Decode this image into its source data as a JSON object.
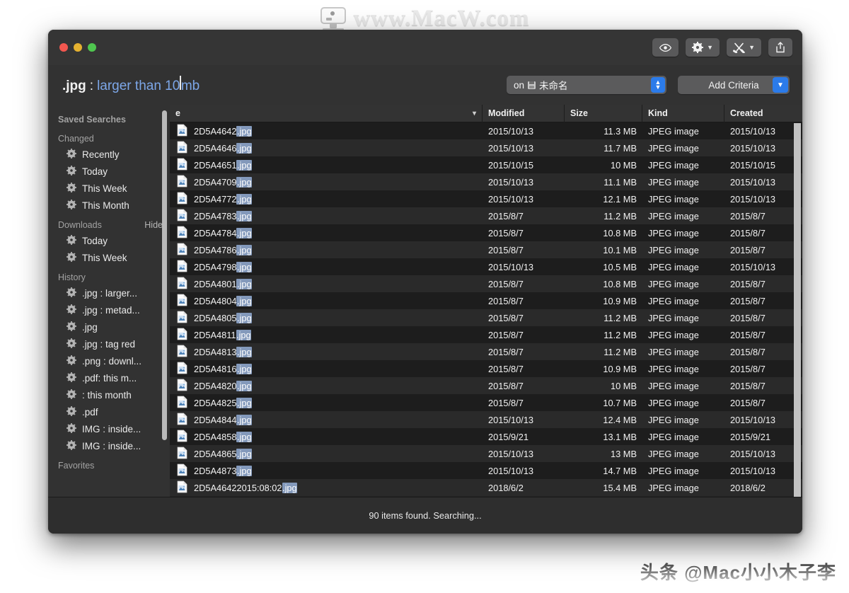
{
  "watermarks": {
    "top": "www.MacW.com",
    "bottom": "头条 @Mac小小木子李"
  },
  "window": {
    "traffic_lights": [
      "close",
      "minimize",
      "maximize"
    ],
    "toolbar": [
      {
        "name": "quick-look",
        "icon": "eye-icon",
        "has_chevron": false
      },
      {
        "name": "action",
        "icon": "gear-icon",
        "has_chevron": true
      },
      {
        "name": "tools",
        "icon": "tools-icon",
        "has_chevron": true
      },
      {
        "name": "share",
        "icon": "share-icon",
        "has_chevron": false
      }
    ]
  },
  "search": {
    "extension": ".jpg",
    "separator": ":",
    "condition_before_caret": "larger than 10",
    "condition_after_caret": "mb",
    "full_query": ".jpg : larger than 10mb",
    "scope_label": "on",
    "scope_value": "未命名",
    "add_criteria_label": "Add Criteria"
  },
  "sidebar": {
    "header": "Saved Searches",
    "sections": [
      {
        "title": "Changed",
        "action": "",
        "items": [
          "Recently",
          "Today",
          "This Week",
          "This Month"
        ]
      },
      {
        "title": "Downloads",
        "action": "Hide",
        "items": [
          "Today",
          "This Week"
        ]
      },
      {
        "title": "History",
        "action": "",
        "items": [
          ".jpg : larger...",
          ".jpg : metad...",
          ".jpg",
          ".jpg : tag red",
          ".png : downl...",
          ".pdf: this m...",
          ": this month",
          ".pdf",
          "IMG : inside...",
          "IMG : inside..."
        ]
      },
      {
        "title": "Favorites",
        "action": "",
        "items": []
      }
    ]
  },
  "file_list": {
    "columns": [
      "e",
      "Modified",
      "Size",
      "Kind",
      "Created"
    ],
    "name_column_full": "Name",
    "sort_indicator": "▾",
    "rows": [
      {
        "name_base": "2D5A4642",
        "name_hl": ".jpg",
        "modified": "2015/10/13",
        "size": "11.3 MB",
        "kind": "JPEG image",
        "created": "2015/10/13"
      },
      {
        "name_base": "2D5A4646",
        "name_hl": ".jpg",
        "modified": "2015/10/13",
        "size": "11.7 MB",
        "kind": "JPEG image",
        "created": "2015/10/13"
      },
      {
        "name_base": "2D5A4651",
        "name_hl": ".jpg",
        "modified": "2015/10/15",
        "size": "10 MB",
        "kind": "JPEG image",
        "created": "2015/10/15"
      },
      {
        "name_base": "2D5A4709",
        "name_hl": ".jpg",
        "modified": "2015/10/13",
        "size": "11.1 MB",
        "kind": "JPEG image",
        "created": "2015/10/13"
      },
      {
        "name_base": "2D5A4772",
        "name_hl": ".jpg",
        "modified": "2015/10/13",
        "size": "12.1 MB",
        "kind": "JPEG image",
        "created": "2015/10/13"
      },
      {
        "name_base": "2D5A4783",
        "name_hl": ".jpg",
        "modified": "2015/8/7",
        "size": "11.2 MB",
        "kind": "JPEG image",
        "created": "2015/8/7"
      },
      {
        "name_base": "2D5A4784",
        "name_hl": ".jpg",
        "modified": "2015/8/7",
        "size": "10.8 MB",
        "kind": "JPEG image",
        "created": "2015/8/7"
      },
      {
        "name_base": "2D5A4786",
        "name_hl": ".jpg",
        "modified": "2015/8/7",
        "size": "10.1 MB",
        "kind": "JPEG image",
        "created": "2015/8/7"
      },
      {
        "name_base": "2D5A4798",
        "name_hl": ".jpg",
        "modified": "2015/10/13",
        "size": "10.5 MB",
        "kind": "JPEG image",
        "created": "2015/10/13"
      },
      {
        "name_base": "2D5A4801",
        "name_hl": ".jpg",
        "modified": "2015/8/7",
        "size": "10.8 MB",
        "kind": "JPEG image",
        "created": "2015/8/7"
      },
      {
        "name_base": "2D5A4804",
        "name_hl": ".jpg",
        "modified": "2015/8/7",
        "size": "10.9 MB",
        "kind": "JPEG image",
        "created": "2015/8/7"
      },
      {
        "name_base": "2D5A4805",
        "name_hl": ".jpg",
        "modified": "2015/8/7",
        "size": "11.2 MB",
        "kind": "JPEG image",
        "created": "2015/8/7"
      },
      {
        "name_base": "2D5A4811",
        "name_hl": ".jpg",
        "modified": "2015/8/7",
        "size": "11.2 MB",
        "kind": "JPEG image",
        "created": "2015/8/7"
      },
      {
        "name_base": "2D5A4813",
        "name_hl": ".jpg",
        "modified": "2015/8/7",
        "size": "11.2 MB",
        "kind": "JPEG image",
        "created": "2015/8/7"
      },
      {
        "name_base": "2D5A4816",
        "name_hl": ".jpg",
        "modified": "2015/8/7",
        "size": "10.9 MB",
        "kind": "JPEG image",
        "created": "2015/8/7"
      },
      {
        "name_base": "2D5A4820",
        "name_hl": ".jpg",
        "modified": "2015/8/7",
        "size": "10 MB",
        "kind": "JPEG image",
        "created": "2015/8/7"
      },
      {
        "name_base": "2D5A4825",
        "name_hl": ".jpg",
        "modified": "2015/8/7",
        "size": "10.7 MB",
        "kind": "JPEG image",
        "created": "2015/8/7"
      },
      {
        "name_base": "2D5A4844",
        "name_hl": ".jpg",
        "modified": "2015/10/13",
        "size": "12.4 MB",
        "kind": "JPEG image",
        "created": "2015/10/13"
      },
      {
        "name_base": "2D5A4858",
        "name_hl": ".jpg",
        "modified": "2015/9/21",
        "size": "13.1 MB",
        "kind": "JPEG image",
        "created": "2015/9/21"
      },
      {
        "name_base": "2D5A4865",
        "name_hl": ".jpg",
        "modified": "2015/10/13",
        "size": "13 MB",
        "kind": "JPEG image",
        "created": "2015/10/13"
      },
      {
        "name_base": "2D5A4873",
        "name_hl": ".jpg",
        "modified": "2015/10/13",
        "size": "14.7 MB",
        "kind": "JPEG image",
        "created": "2015/10/13"
      },
      {
        "name_base": "2D5A46422015:08:02",
        "name_hl": ".jpg",
        "modified": "2018/6/2",
        "size": "15.4 MB",
        "kind": "JPEG image",
        "created": "2018/6/2"
      }
    ]
  },
  "status": {
    "text": "90 items found. Searching..."
  },
  "colors": {
    "accent_blue": "#2b7bea",
    "query_blue": "#7da7e8",
    "highlight": "#8399bb",
    "window_bg": "#323232",
    "row_dark": "#1d1d1d",
    "row_light": "#2a2a2a"
  }
}
